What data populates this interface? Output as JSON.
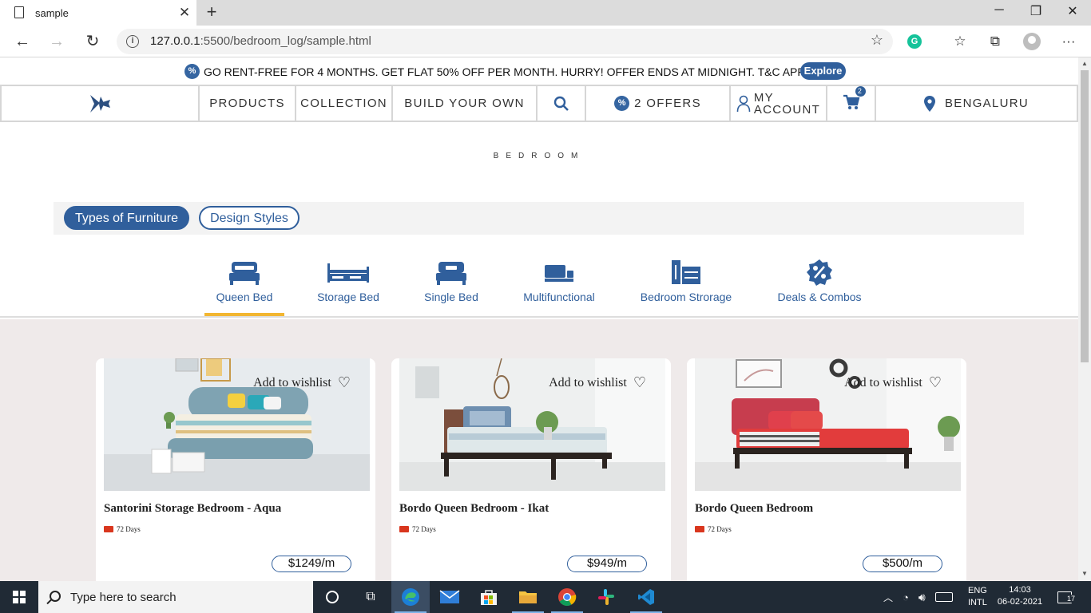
{
  "browser": {
    "tab_title": "sample",
    "url_host": "127.0.0.1",
    "url_path": ":5500/bedroom_log/sample.html"
  },
  "promo": {
    "text": "GO RENT-FREE FOR 4 MONTHS. GET FLAT 50% OFF PER MONTH. HURRY! OFFER ENDS AT MIDNIGHT. T&C APPLY",
    "button": "Explore"
  },
  "nav": {
    "products": "PRODUCTS",
    "collection": "COLLECTION",
    "build": "BUILD YOUR OWN",
    "offers": "2 OFFERS",
    "account_line1": "MY",
    "account_line2": "ACCOUNT",
    "cart_count": "2",
    "location": "BENGALURU"
  },
  "page": {
    "title": "BEDROOM"
  },
  "filters": {
    "active": "Types of Furniture",
    "inactive": "Design Styles"
  },
  "categories": [
    {
      "label": "Queen Bed",
      "icon": "queen-bed-icon"
    },
    {
      "label": "Storage Bed",
      "icon": "storage-bed-icon"
    },
    {
      "label": "Single Bed",
      "icon": "single-bed-icon"
    },
    {
      "label": "Multifunctional",
      "icon": "multifunctional-icon"
    },
    {
      "label": "Bedroom Strorage",
      "icon": "bedroom-storage-icon"
    },
    {
      "label": "Deals & Combos",
      "icon": "deals-icon"
    }
  ],
  "products": [
    {
      "name": "Santorini Storage Bedroom - Aqua",
      "days": "72 Days",
      "price": "$1249/m",
      "wishlist": "Add to wishlist"
    },
    {
      "name": "Bordo Queen Bedroom - Ikat",
      "days": "72 Days",
      "price": "$949/m",
      "wishlist": "Add to wishlist"
    },
    {
      "name": "Bordo Queen Bedroom",
      "days": "72 Days",
      "price": "$500/m",
      "wishlist": "Add to wishlist"
    }
  ],
  "taskbar": {
    "search_placeholder": "Type here to search",
    "lang_line1": "ENG",
    "lang_line2": "INTL",
    "time": "14:03",
    "date": "06-02-2021",
    "notifications": "17"
  },
  "colors": {
    "brand_blue": "#305f9c",
    "accent_yellow": "#f2b632",
    "listing_bg": "#efeaea"
  }
}
